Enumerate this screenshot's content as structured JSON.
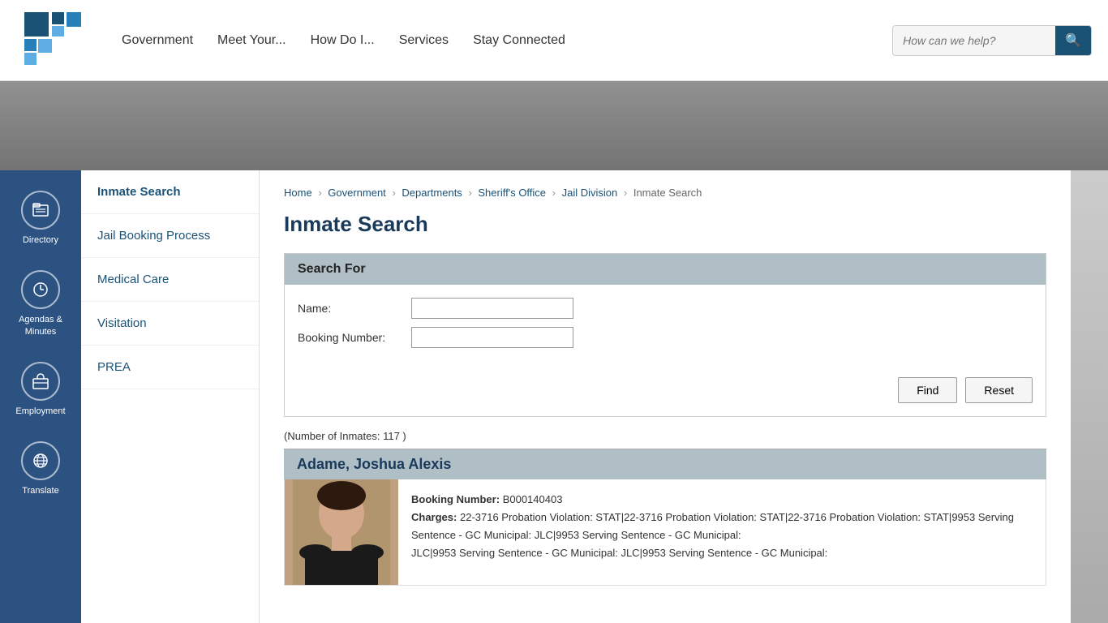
{
  "header": {
    "nav": [
      {
        "label": "Government",
        "id": "nav-government"
      },
      {
        "label": "Meet Your...",
        "id": "nav-meet"
      },
      {
        "label": "How Do I...",
        "id": "nav-howdoi"
      },
      {
        "label": "Services",
        "id": "nav-services"
      },
      {
        "label": "Stay Connected",
        "id": "nav-connected"
      }
    ],
    "search_placeholder": "How can we help?"
  },
  "sidebar_icons": [
    {
      "icon": "📁",
      "label": "Directory",
      "id": "icon-directory",
      "unicode": "&#128193;"
    },
    {
      "icon": "🕐",
      "label": "Agendas &\nMinutes",
      "id": "icon-agendas",
      "unicode": "&#128336;"
    },
    {
      "icon": "💼",
      "label": "Employment",
      "id": "icon-employment",
      "unicode": "&#128188;"
    },
    {
      "icon": "🌐",
      "label": "Translate",
      "id": "icon-translate",
      "unicode": "&#127760;"
    }
  ],
  "sidebar_nav": [
    {
      "label": "Inmate Search",
      "active": true,
      "id": "nav-inmate-search"
    },
    {
      "label": "Jail Booking Process",
      "active": false,
      "id": "nav-jail-booking"
    },
    {
      "label": "Medical Care",
      "active": false,
      "id": "nav-medical"
    },
    {
      "label": "Visitation",
      "active": false,
      "id": "nav-visitation"
    },
    {
      "label": "PREA",
      "active": false,
      "id": "nav-prea"
    }
  ],
  "breadcrumb": {
    "items": [
      "Home",
      "Government",
      "Departments",
      "Sheriff's Office",
      "Jail Division",
      "Inmate Search"
    ],
    "separators": [
      "›",
      "›",
      "›",
      "›",
      "›"
    ]
  },
  "page_title": "Inmate Search",
  "search_form": {
    "header": "Search For",
    "name_label": "Name:",
    "booking_label": "Booking Number:",
    "find_btn": "Find",
    "reset_btn": "Reset"
  },
  "inmate_count": "(Number of Inmates: 117 )",
  "inmate": {
    "name": "Adame, Joshua Alexis",
    "booking_number_label": "Booking Number:",
    "booking_number": "B000140403",
    "charges_label": "Charges:",
    "charges": "22-3716 Probation Violation: STAT|22-3716 Probation Violation: STAT|22-3716 Probation Violation: STAT|9953 Serving Sentence - GC Municipal: JLC|9953 Serving Sentence - GC Municipal: JLC|9953 Serving Sentence - GC Municipal:"
  },
  "colors": {
    "dark_blue": "#2c5282",
    "medium_blue": "#1a5276",
    "header_bg": "#b0bec5",
    "light_gray_bg": "#f5f5f5"
  }
}
